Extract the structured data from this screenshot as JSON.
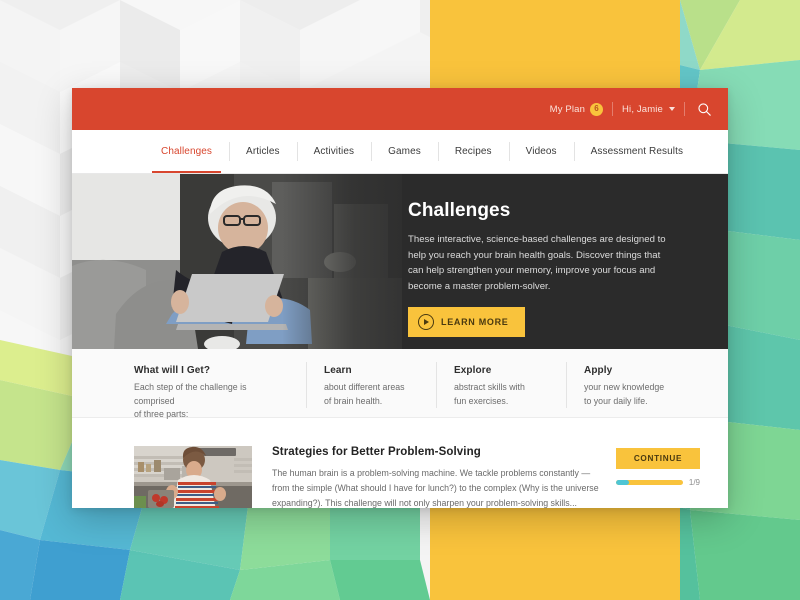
{
  "header": {
    "my_plan_label": "My Plan",
    "my_plan_count": "6",
    "greeting": "Hi, Jamie",
    "search_icon": "search-icon",
    "bar_color": "#d8462e"
  },
  "nav": {
    "tabs": [
      {
        "label": "Challenges",
        "active": true
      },
      {
        "label": "Articles",
        "active": false
      },
      {
        "label": "Activities",
        "active": false
      },
      {
        "label": "Games",
        "active": false
      },
      {
        "label": "Recipes",
        "active": false
      },
      {
        "label": "Videos",
        "active": false
      },
      {
        "label": "Assessment Results",
        "active": false
      }
    ]
  },
  "hero": {
    "title": "Challenges",
    "body": "These interactive, science-based challenges are designed to help you reach your brain health goals. Discover things that can help strengthen your memory, improve your focus and become a master problem-solver.",
    "cta_label": "LEARN MORE",
    "cta_icon": "play-circle-icon",
    "cta_color": "#f9c33c",
    "image_alt": "woman-with-laptop-photo"
  },
  "parts": {
    "intro_title": "What will I Get?",
    "intro_line1": "Each step of the challenge is comprised",
    "intro_line2": "of three parts:",
    "items": [
      {
        "title": "Learn",
        "line1": "about different areas",
        "line2": "of brain health."
      },
      {
        "title": "Explore",
        "line1": "abstract skills with",
        "line2": "fun exercises."
      },
      {
        "title": "Apply",
        "line1": "your new knowledge",
        "line2": "to your daily life."
      }
    ]
  },
  "challenge": {
    "thumb_alt": "woman-cooking-in-kitchen-thumbnail",
    "title": "Strategies for Better Problem-Solving",
    "text": "The human brain is a problem-solving machine. We tackle problems constantly — from the simple (What should I have for lunch?) to the complex (Why is the universe expanding?). This challenge will not only sharpen your problem-solving skills...",
    "continue_label": "CONTINUE",
    "progress_label": "1/9",
    "progress_percent": 20,
    "progress_fill_color": "#4ec5d4",
    "progress_track_color": "#f9c33c"
  },
  "background": {
    "yellow_band_color": "#f9c33c",
    "pattern": "low-poly-triangles"
  }
}
